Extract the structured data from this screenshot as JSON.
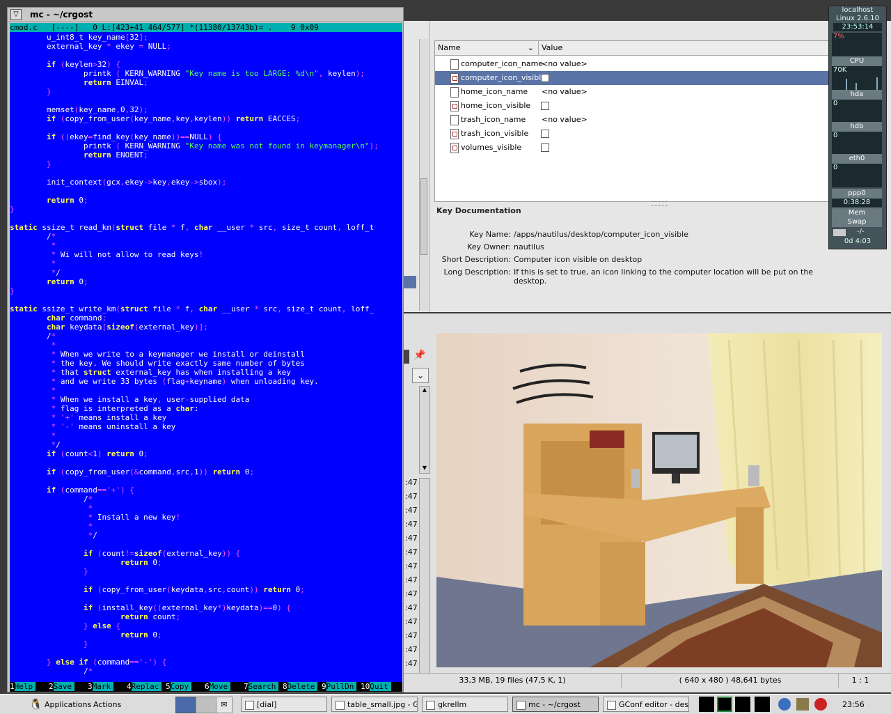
{
  "mc": {
    "title": "mc - ~/crgost",
    "status_line": "cmod.c   [----]   0 L:[423+41 464/577] *(11380/13743b)= .    9 0x09",
    "code_lines": [
      "        u_int8_t key_name[32];",
      "        external_key * ekey = NULL;",
      "",
      "        if (keylen>32) {",
      "                printk ( KERN_WARNING \"Key name is too LARGE: %d\\n\", keylen);",
      "                return EINVAL;",
      "        }",
      "",
      "        memset(key_name,0,32);",
      "        if (copy_from_user(key_name,key,keylen)) return EACCES;",
      "",
      "        if ((ekey=find_key(key_name))==NULL) {",
      "                printk ( KERN_WARNING \"Key name was not found in keymanager\\n\");",
      "                return ENOENT;",
      "        }",
      "",
      "        init_context(gcx,ekey->key,ekey->sbox);",
      "",
      "        return 0;",
      "}",
      "",
      "static ssize_t read_km(struct file * f, char __user * src, size_t count, loff_t",
      "        /*",
      "         *",
      "         * Wi will not allow to read keys!",
      "         *",
      "         */",
      "        return 0;",
      "}",
      "",
      "static ssize_t write_km(struct file * f, char __user * src, size_t count, loff_",
      "        char command;",
      "        char keydata[sizeof(external_key)];",
      "        /*",
      "         *",
      "         * When we write to a keymanager we install or deinstall",
      "         * the key. We should write exactly same number of bytes",
      "         * that struct external_key has when installing a key",
      "         * and we write 33 bytes (flag+keyname) when unloading key.",
      "         *",
      "         * When we install a key, user-supplied data",
      "         * flag is interpreted as a char:",
      "         * '+' means install a key",
      "         * '-' means uninstall a key",
      "         *",
      "         */",
      "        if (count<1) return 0;",
      "",
      "        if (copy_from_user(&command,src,1)) return 0;",
      "",
      "        if (command=='+') {",
      "                /*",
      "                 *",
      "                 * Install a new key!",
      "                 *",
      "                 */",
      "",
      "                if (count!=sizeof(external_key)) {",
      "                        return 0;",
      "                }",
      "",
      "                if (copy_from_user(keydata,src,count)) return 0;",
      "",
      "                if (install_key((external_key*)keydata)==0) {",
      "                        return count;",
      "                } else {",
      "                        return 0;",
      "                }",
      "",
      "        } else if (command=='-') {",
      "                /*"
    ],
    "fkeys": [
      {
        "n": "1",
        "l": "Help"
      },
      {
        "n": "2",
        "l": "Save"
      },
      {
        "n": "3",
        "l": "Mark"
      },
      {
        "n": "4",
        "l": "Replac"
      },
      {
        "n": "5",
        "l": "Copy"
      },
      {
        "n": "6",
        "l": "Move"
      },
      {
        "n": "7",
        "l": "Search"
      },
      {
        "n": "8",
        "l": "Delete"
      },
      {
        "n": "9",
        "l": "PullDn"
      },
      {
        "n": "10",
        "l": "Quit"
      }
    ]
  },
  "gconf": {
    "col_name": "Name",
    "col_value": "Value",
    "rows": [
      {
        "name": "computer_icon_name",
        "value": "<no value>",
        "type": "string",
        "selected": false
      },
      {
        "name": "computer_icon_visible",
        "value": "",
        "type": "bool",
        "selected": true
      },
      {
        "name": "home_icon_name",
        "value": "<no value>",
        "type": "string",
        "selected": false
      },
      {
        "name": "home_icon_visible",
        "value": "",
        "type": "bool",
        "selected": false
      },
      {
        "name": "trash_icon_name",
        "value": "<no value>",
        "type": "string",
        "selected": false
      },
      {
        "name": "trash_icon_visible",
        "value": "",
        "type": "bool",
        "selected": false
      },
      {
        "name": "volumes_visible",
        "value": "",
        "type": "bool",
        "selected": false
      }
    ],
    "doc_title": "Key Documentation",
    "doc": [
      {
        "label": "Key Name:",
        "value": "/apps/nautilus/desktop/computer_icon_visible"
      },
      {
        "label": "Key Owner:",
        "value": "nautilus"
      },
      {
        "label": "Short Description:",
        "value": "Computer icon visible on desktop"
      },
      {
        "label": "Long Description:",
        "value": "If this is set to true, an icon linking to the computer location will be put on the desktop."
      }
    ]
  },
  "gkrellm": {
    "host": "localhost",
    "kernel": "Linux 2.6.10",
    "clock": "23:53:14",
    "cpu_pct": "7%",
    "cpu_label": "CPU",
    "proc": "70K",
    "hda": "hda",
    "hda_val": "0",
    "hdb": "hdb",
    "hdb_val": "0",
    "eth0": "eth0",
    "eth0_val": "0",
    "ppp0": "ppp0",
    "ppp0_time": "0:38:28",
    "mem": "Mem",
    "swap": "Swap",
    "mail": "-/-",
    "uptime": "0d  4:03"
  },
  "gqview": {
    "times": [
      ":47",
      ":47",
      ":47",
      ":47",
      ":47",
      ":47",
      ":47",
      ":47",
      ":47",
      ":47",
      ":47",
      ":47",
      ":47",
      ":47"
    ],
    "status_files": "33,3 MB, 19 files (47,5 K, 1)",
    "status_image": "( 640 x 480 ) 48,641 bytes",
    "status_zoom": "1 : 1"
  },
  "taskbar": {
    "applications": "Applications",
    "actions": "Actions",
    "tasks": [
      "[dial]",
      "table_small.jpg - GQvi",
      "gkrellm",
      "mc - ~/crgost",
      "GConf editor - desktop"
    ],
    "clock": "23:56"
  },
  "colors": {
    "term_bg": "#0000ff",
    "keyword": "#ffff55",
    "string": "#55ff55",
    "selection": "#5a74a8"
  }
}
